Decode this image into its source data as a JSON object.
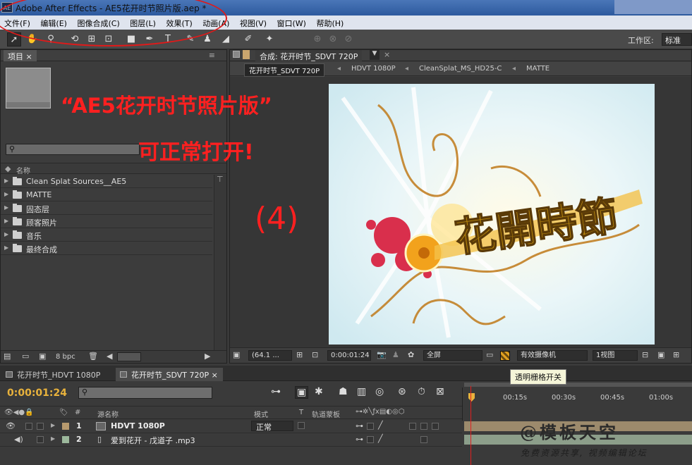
{
  "window": {
    "title": "Adobe After Effects - AE5花开时节照片版.aep *",
    "app_icon": "AE"
  },
  "menu": [
    "文件(F)",
    "编辑(E)",
    "图像合成(C)",
    "图层(L)",
    "效果(T)",
    "动画(A)",
    "视图(V)",
    "窗口(W)",
    "帮助(H)"
  ],
  "toolbar": {
    "workspace_label": "工作区:",
    "workspace_value": "标准",
    "tools": [
      "selection-icon",
      "hand-icon",
      "zoom-icon",
      "rotate-icon",
      "camera-orbit-icon",
      "pan-behind-icon",
      "rectangle-icon",
      "pen-icon",
      "type-icon",
      "brush-icon",
      "clone-stamp-icon",
      "eraser-icon",
      "roto-brush-icon",
      "puppet-pin-icon"
    ]
  },
  "project": {
    "tab_label": "项目",
    "column_name": "名称",
    "items": [
      "Clean Splat Sources__AE5",
      "MATTE",
      "固态层",
      "顾客照片",
      "音乐",
      "最终合成"
    ],
    "bpc": "8 bpc"
  },
  "annotation": {
    "line1": "“AE5花开时节照片版”",
    "line2": "可正常打开!",
    "step": "(4)"
  },
  "composition": {
    "tab_label": "合成: 花开时节_SDVT 720P",
    "breadcrumbs": [
      "花开时节_SDVT 720P",
      "HDVT 1080P",
      "CleanSplat_MS_HD25-C",
      "MATTE"
    ],
    "preview_text": "花開時節",
    "zoom": "(64.1 ...",
    "timecode": "0:00:01:24",
    "resolution": "全屏",
    "camera": "有效摄像机",
    "views": "1视图",
    "tooltip": "透明栅格开关"
  },
  "timeline": {
    "tabs": [
      "花开时节_HDVT 1080P",
      "花开时节_SDVT 720P"
    ],
    "current_time": "0:00:01:24",
    "columns": {
      "num": "#",
      "source": "源名称",
      "mode": "模式",
      "t": "T",
      "trkmat": "轨道蒙板"
    },
    "ruler_ticks": [
      "00:15s",
      "00:30s",
      "00:45s",
      "01:00s"
    ],
    "layers": [
      {
        "num": "1",
        "name": "HDVT 1080P",
        "mode": "正常",
        "color": "#b79a6e"
      },
      {
        "num": "2",
        "name": "爱到花开 - 戊道子 .mp3",
        "mode": "",
        "color": "#9cb89c"
      }
    ]
  },
  "watermark": {
    "line1": "@模板天空",
    "line2": "免费资源共享, 视频编辑论坛"
  },
  "colors": {
    "timecode": "#e8b23c",
    "annotation": "#ff2020",
    "accent": "#2d5a9e"
  }
}
